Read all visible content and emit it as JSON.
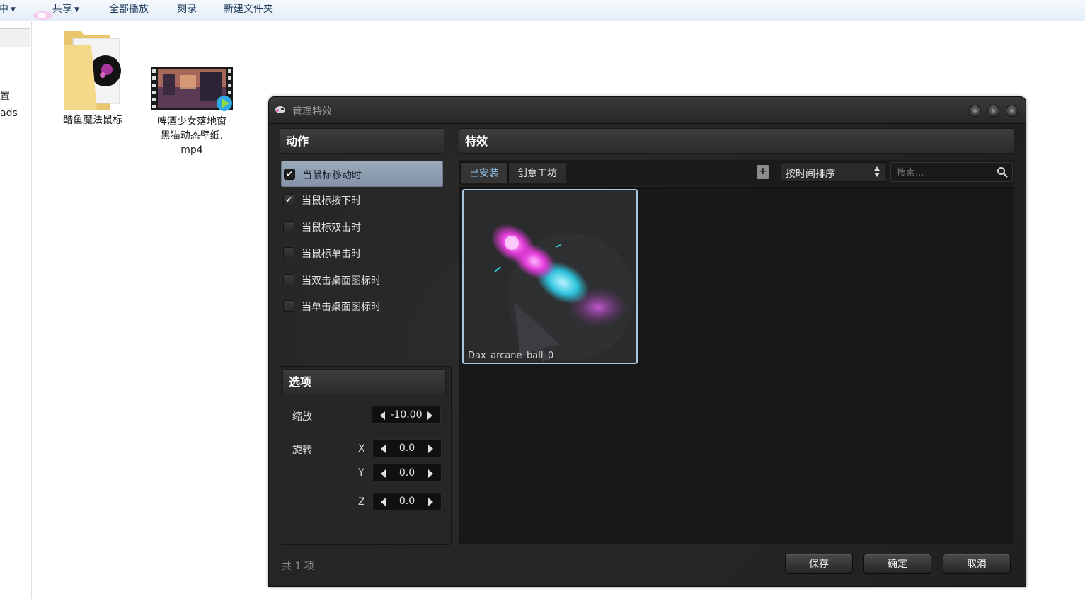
{
  "explorer": {
    "toolbar": {
      "items": [
        {
          "label": "库中",
          "has_dropdown": true
        },
        {
          "label": "共享",
          "has_dropdown": true
        },
        {
          "label": "全部播放"
        },
        {
          "label": "刻录"
        },
        {
          "label": "新建文件夹"
        }
      ]
    },
    "left_pane": {
      "partial_labels": [
        "置",
        "ads"
      ]
    },
    "files": [
      {
        "name": "酷鱼魔法鼠标",
        "type": "folder-icon"
      },
      {
        "name": "啤酒少女落地窗\n黑猫动态壁纸.\nmp4",
        "type": "video-file-icon"
      }
    ]
  },
  "dialog": {
    "title": "管理特效",
    "actions": {
      "heading": "动作",
      "items": [
        {
          "label": "当鼠标移动时",
          "checked": true,
          "selected": true
        },
        {
          "label": "当鼠标按下时",
          "checked": true,
          "selected": false
        },
        {
          "label": "当鼠标双击时",
          "checked": false,
          "selected": false
        },
        {
          "label": "当鼠标单击时",
          "checked": false,
          "selected": false
        },
        {
          "label": "当双击桌面图标时",
          "checked": false,
          "selected": false
        },
        {
          "label": "当单击桌面图标时",
          "checked": false,
          "selected": false
        }
      ]
    },
    "options": {
      "heading": "选项",
      "scale_label": "缩放",
      "scale_value": "-10.00",
      "rotate_label": "旋转",
      "x_label": "X",
      "x_value": "0.0",
      "y_label": "Y",
      "y_value": "0.0",
      "z_label": "Z",
      "z_value": "0.0"
    },
    "effects": {
      "heading": "特效",
      "tabs": [
        {
          "label": "已安装",
          "active": true
        },
        {
          "label": "创意工坊",
          "active": false
        }
      ],
      "sort_value": "按时间排序",
      "search_placeholder": "搜索...",
      "items": [
        {
          "name": "Dax_arcane_ball_0",
          "selected": true
        }
      ]
    },
    "count_text": "共 1 项",
    "buttons": {
      "save": "保存",
      "ok": "确定",
      "cancel": "取消"
    }
  },
  "colors": {
    "dialog_bg": "#262626",
    "selected_row": "#94a4b6",
    "active_tab_text": "#8ec0e8",
    "card_border": "#a9c4dc",
    "toolbar_text": "#1e395b"
  }
}
